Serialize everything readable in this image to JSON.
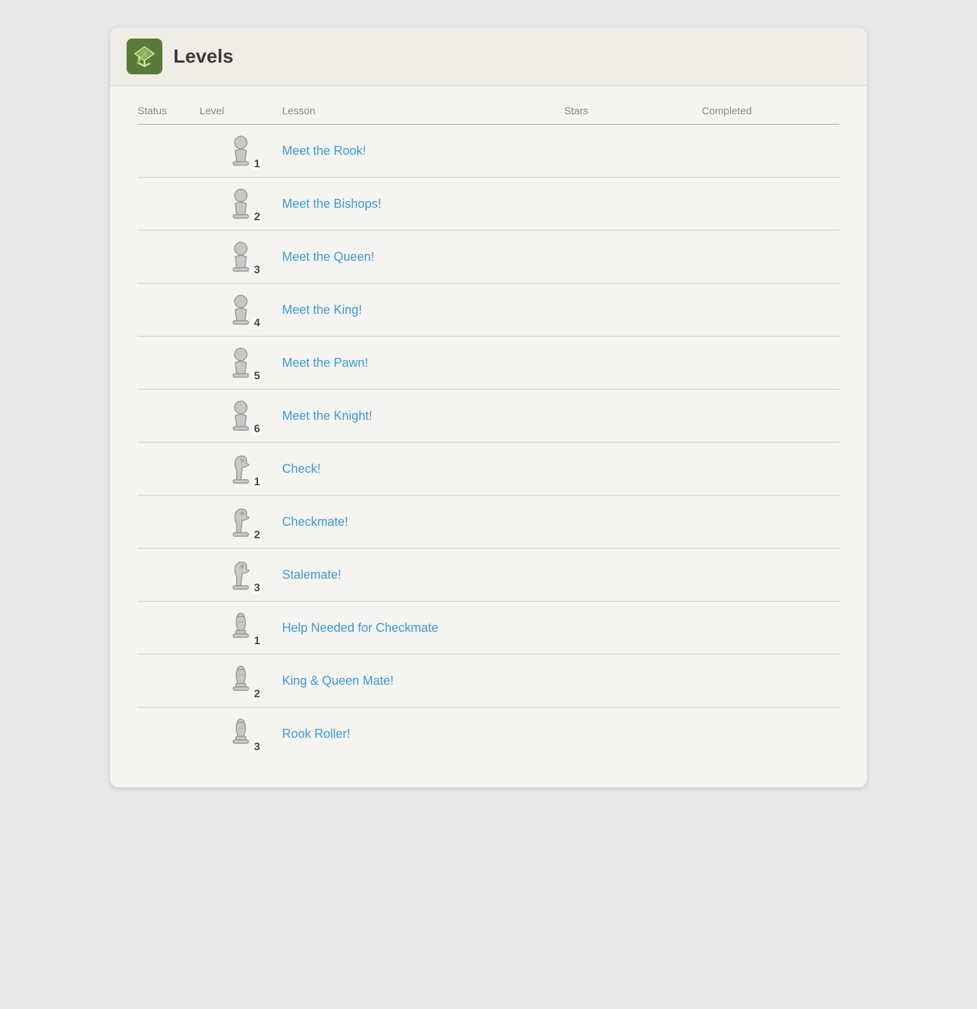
{
  "header": {
    "title": "Levels",
    "icon_label": "levels-icon"
  },
  "table": {
    "columns": [
      {
        "key": "status",
        "label": "Status"
      },
      {
        "key": "level",
        "label": "Level"
      },
      {
        "key": "lesson",
        "label": "Lesson"
      },
      {
        "key": "stars",
        "label": "Stars"
      },
      {
        "key": "completed",
        "label": "Completed"
      }
    ],
    "rows": [
      {
        "status": "",
        "level": "pawn-1",
        "piece_type": "pawn",
        "number": "1",
        "lesson": "Meet the Rook!",
        "stars": "",
        "completed": ""
      },
      {
        "status": "",
        "level": "pawn-2",
        "piece_type": "pawn",
        "number": "2",
        "lesson": "Meet the Bishops!",
        "stars": "",
        "completed": ""
      },
      {
        "status": "",
        "level": "pawn-3",
        "piece_type": "pawn",
        "number": "3",
        "lesson": "Meet the Queen!",
        "stars": "",
        "completed": ""
      },
      {
        "status": "",
        "level": "pawn-4",
        "piece_type": "pawn",
        "number": "4",
        "lesson": "Meet the King!",
        "stars": "",
        "completed": ""
      },
      {
        "status": "",
        "level": "pawn-5",
        "piece_type": "pawn",
        "number": "5",
        "lesson": "Meet the Pawn!",
        "stars": "",
        "completed": ""
      },
      {
        "status": "",
        "level": "pawn-6",
        "piece_type": "pawn",
        "number": "6",
        "lesson": "Meet the Knight!",
        "stars": "",
        "completed": ""
      },
      {
        "status": "",
        "level": "knight-1",
        "piece_type": "knight",
        "number": "1",
        "lesson": "Check!",
        "stars": "",
        "completed": ""
      },
      {
        "status": "",
        "level": "knight-2",
        "piece_type": "knight",
        "number": "2",
        "lesson": "Checkmate!",
        "stars": "",
        "completed": ""
      },
      {
        "status": "",
        "level": "knight-3",
        "piece_type": "knight",
        "number": "3",
        "lesson": "Stalemate!",
        "stars": "",
        "completed": ""
      },
      {
        "status": "",
        "level": "bishop-1",
        "piece_type": "bishop",
        "number": "1",
        "lesson": "Help Needed for Checkmate",
        "stars": "",
        "completed": ""
      },
      {
        "status": "",
        "level": "bishop-2",
        "piece_type": "bishop",
        "number": "2",
        "lesson": "King & Queen Mate!",
        "stars": "",
        "completed": ""
      },
      {
        "status": "",
        "level": "bishop-3",
        "piece_type": "bishop",
        "number": "3",
        "lesson": "Rook Roller!",
        "stars": "",
        "completed": ""
      }
    ]
  }
}
